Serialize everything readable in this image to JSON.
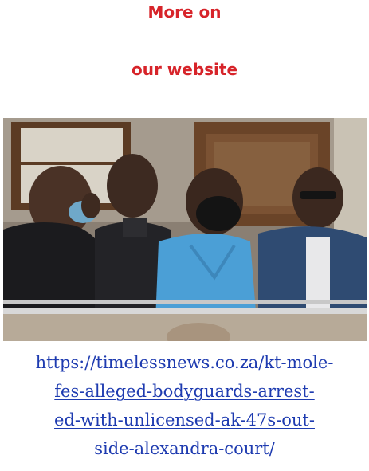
{
  "headline": {
    "line1": "More on",
    "line2": "our website",
    "color": "#d7242a"
  },
  "photo": {
    "subject": "courtroom-photo"
  },
  "link": {
    "lines": [
      "https://timelessnews.co.za/kt-mole-",
      "fes-alleged-bodyguards-arrest-",
      "ed-with-unlicensed-ak-47s-out-",
      "side-alexandra-court/"
    ],
    "color": "#1e3bb0"
  }
}
